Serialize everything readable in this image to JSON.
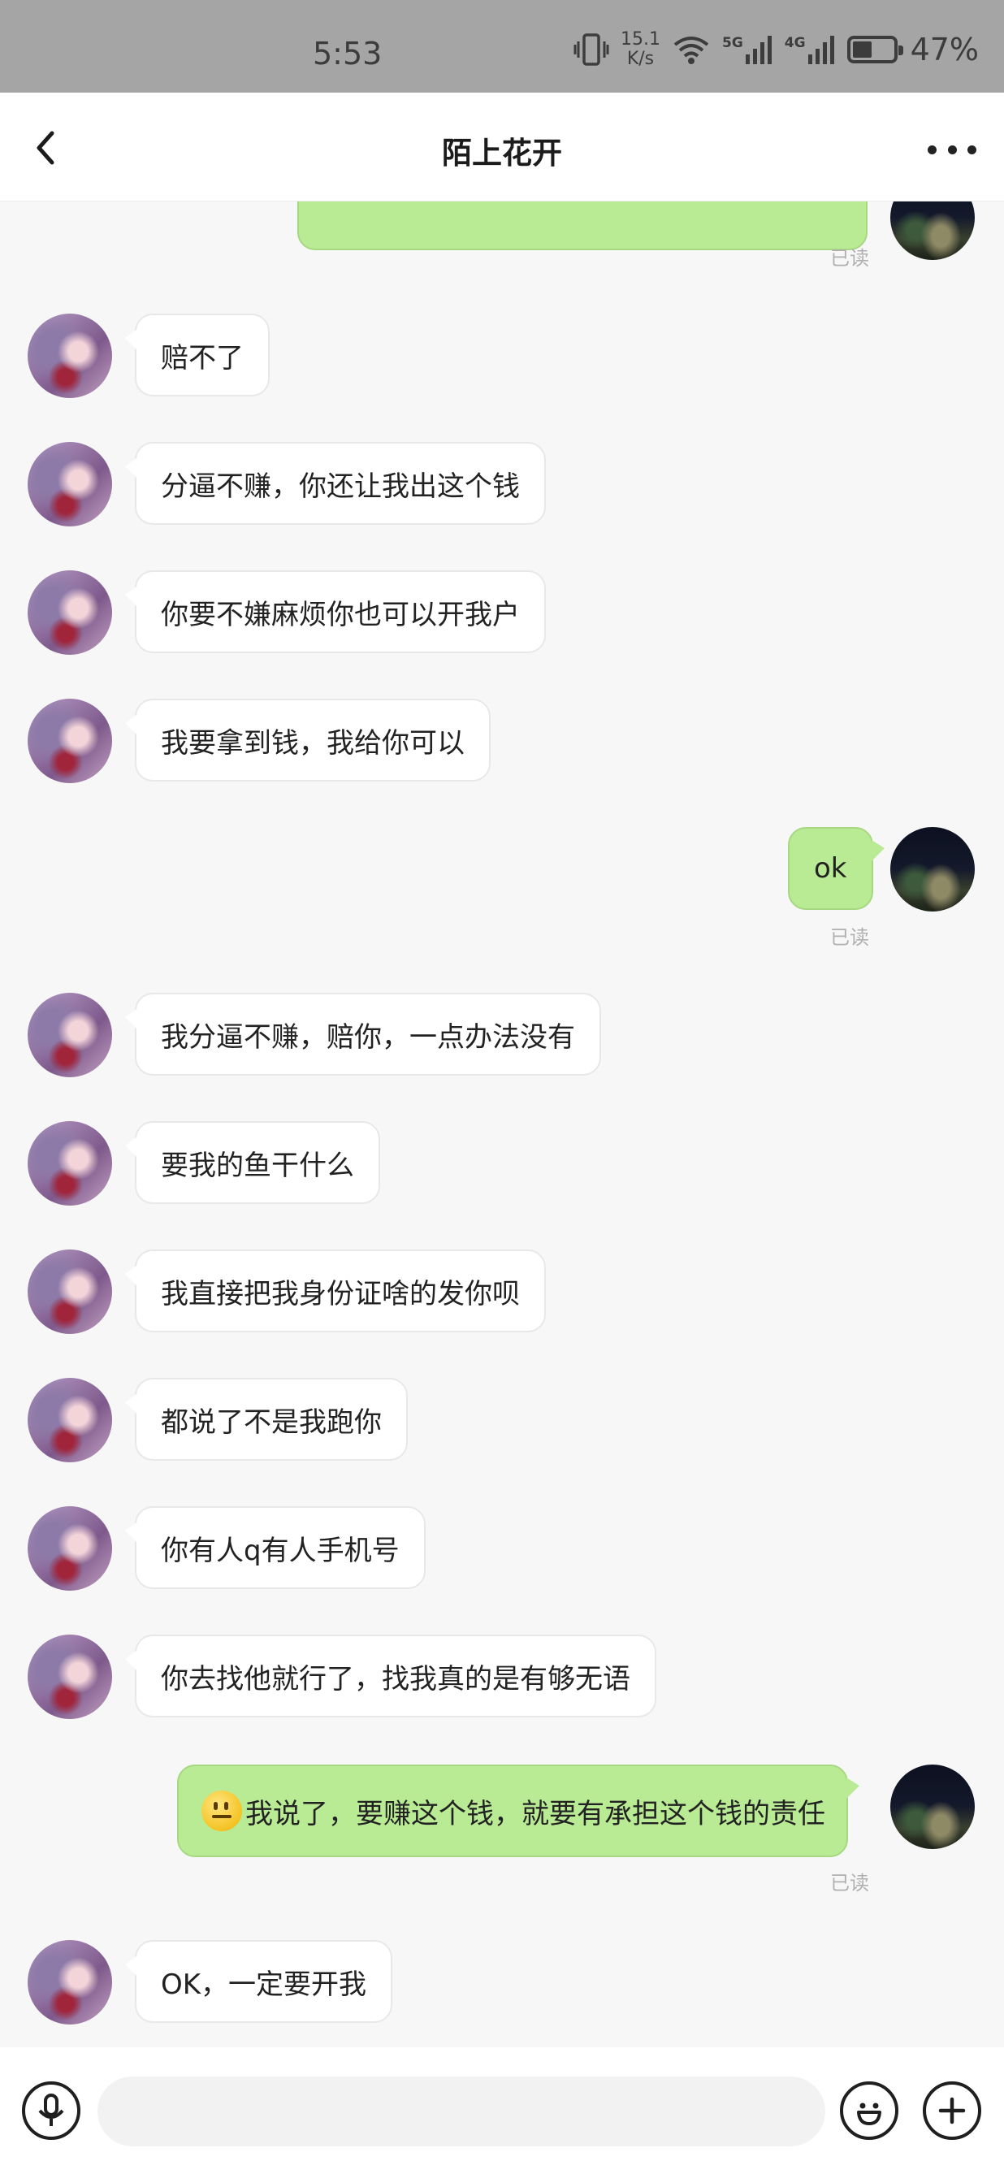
{
  "status_bar": {
    "time": "5:53",
    "net_speed_value": "15.1",
    "net_speed_unit": "K/s",
    "signal_a": "5G",
    "signal_b": "4G",
    "battery_percent": "47%",
    "battery_level": 0.47
  },
  "header": {
    "title": "陌上花开"
  },
  "messages": [
    {
      "from": "self",
      "text": "",
      "read_receipt": "已读"
    },
    {
      "from": "other",
      "text": "赔不了"
    },
    {
      "from": "other",
      "text": "分逼不赚，你还让我出这个钱"
    },
    {
      "from": "other",
      "text": "你要不嫌麻烦你也可以开我户"
    },
    {
      "from": "other",
      "text": "我要拿到钱，我给你可以"
    },
    {
      "from": "self",
      "text": "ok",
      "read_receipt": "已读"
    },
    {
      "from": "other",
      "text": "我分逼不赚，赔你，一点办法没有"
    },
    {
      "from": "other",
      "text": "要我的鱼干什么"
    },
    {
      "from": "other",
      "text": "我直接把我身份证啥的发你呗"
    },
    {
      "from": "other",
      "text": "都说了不是我跑你"
    },
    {
      "from": "other",
      "text": "你有人q有人手机号"
    },
    {
      "from": "other",
      "text": "你去找他就行了，找我真的是有够无语"
    },
    {
      "from": "self",
      "emoji": "smile-emoji",
      "text": "我说了，要赚这个钱，就要有承担这个钱的责任",
      "read_receipt": "已读"
    },
    {
      "from": "other",
      "text": "OK，一定要开我"
    }
  ],
  "input_bar": {
    "placeholder": "",
    "voice_icon": "microphone-icon",
    "emoji_icon": "smiley-icon",
    "add_icon": "plus-icon"
  },
  "colors": {
    "outgoing_bubble": "#b9eb95",
    "incoming_bubble": "#ffffff",
    "background": "#f7f7f7",
    "status_bar": "#a5a5a5"
  }
}
